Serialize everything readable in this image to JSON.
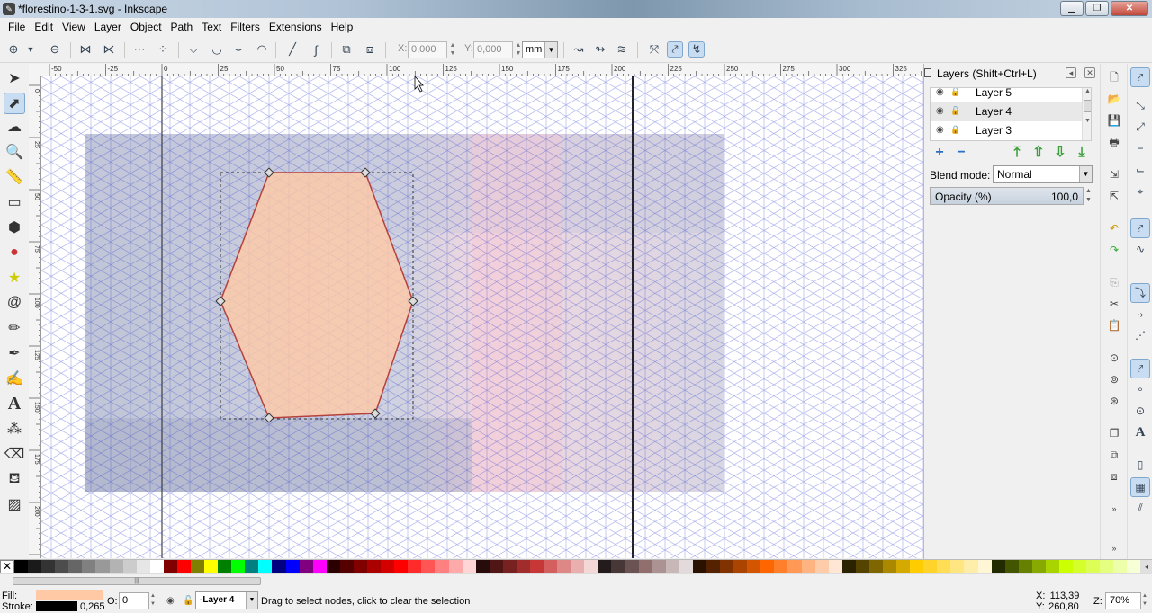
{
  "window": {
    "title": "*florestino-1-3-1.svg - Inkscape",
    "controls": {
      "minimize": "▁",
      "maximize": "❐",
      "close": "✕"
    }
  },
  "menu": [
    "File",
    "Edit",
    "View",
    "Layer",
    "Object",
    "Path",
    "Text",
    "Filters",
    "Extensions",
    "Help"
  ],
  "tool_controls": {
    "x_label": "X:",
    "x_value": "0,000",
    "y_label": "Y:",
    "y_value": "0,000",
    "units": "mm"
  },
  "rulers": {
    "top_ticks": [
      "-50",
      "-25",
      "0",
      "25",
      "50",
      "75",
      "100",
      "125",
      "150",
      "175",
      "200",
      "225",
      "250",
      "275",
      "300",
      "325"
    ],
    "left_ticks": [
      "0",
      "25",
      "50",
      "75",
      "100",
      "125",
      "150",
      "175",
      "200",
      "225"
    ]
  },
  "canvas": {
    "shape_fill": "#ffc9a6",
    "shape_stroke": "#b5413c",
    "grid_color": "#2f3fcf",
    "page_tint": "#3d4f95"
  },
  "layers_panel": {
    "title": "Layers (Shift+Ctrl+L)",
    "layers": [
      {
        "name": "Layer 5"
      },
      {
        "name": "Layer 4"
      },
      {
        "name": "Layer 3"
      }
    ],
    "blend_label": "Blend mode:",
    "blend_value": "Normal",
    "opacity_label": "Opacity (%)",
    "opacity_value": "100,0"
  },
  "status_bar": {
    "fill_label": "Fill:",
    "stroke_label": "Stroke:",
    "fill_color": "#ffc9a6",
    "stroke_color": "#000000",
    "stroke_width": "0,265",
    "opacity_label": "O:",
    "opacity_value": "0",
    "current_layer": "-Layer 4",
    "message": "Drag to select nodes, click to clear the selection",
    "x_label": "X:",
    "x_value": "113,39",
    "y_label": "Y:",
    "y_value": "260,80",
    "zoom_label": "Z:",
    "zoom_value": "70%"
  },
  "palette": [
    "#000000",
    "#1a1a1a",
    "#333333",
    "#4d4d4d",
    "#666666",
    "#808080",
    "#999999",
    "#b3b3b3",
    "#cccccc",
    "#e6e6e6",
    "#ffffff",
    "#800000",
    "#ff0000",
    "#808000",
    "#ffff00",
    "#008000",
    "#00ff00",
    "#008080",
    "#00ffff",
    "#000080",
    "#0000ff",
    "#800080",
    "#ff00ff",
    "#2b0000",
    "#550000",
    "#800000",
    "#aa0000",
    "#d40000",
    "#ff0000",
    "#ff2a2a",
    "#ff5555",
    "#ff8080",
    "#ffaaaa",
    "#ffd5d5",
    "#280b0b",
    "#501616",
    "#782121",
    "#a02c2c",
    "#c83737",
    "#d35f5f",
    "#de8787",
    "#e9afaf",
    "#f4d7d7",
    "#241c1c",
    "#483737",
    "#6c5353",
    "#916f6f",
    "#ac9393",
    "#c8b7b7",
    "#e3dbdb",
    "#2b1100",
    "#552200",
    "#803300",
    "#aa4400",
    "#d45500",
    "#ff6600",
    "#ff7f2a",
    "#ff9955",
    "#ffb380",
    "#ffccaa",
    "#ffe6d5",
    "#2b2200",
    "#554400",
    "#806600",
    "#aa8800",
    "#d4aa00",
    "#ffcc00",
    "#ffd42a",
    "#ffdd55",
    "#ffe680",
    "#ffeeaa",
    "#fff6d5",
    "#222b00",
    "#445500",
    "#668000",
    "#88aa00",
    "#aad400",
    "#ccff00",
    "#d4ff2a",
    "#ddff55",
    "#e5ff80",
    "#eeffaa",
    "#f6ffd5"
  ]
}
